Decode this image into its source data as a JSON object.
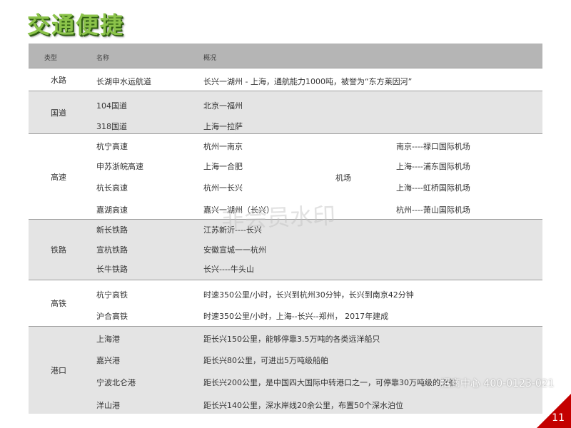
{
  "title": "交通便捷",
  "table": {
    "headers": {
      "type": "类型",
      "name": "名称",
      "desc": "概况"
    },
    "groups": [
      {
        "type": "水路",
        "rows": [
          {
            "name": "长湖申水运航道",
            "desc": "长兴一湖州 - 上海，通航能力1000吨，被誉为“东方莱因河”"
          }
        ]
      },
      {
        "type": "国道",
        "rows": [
          {
            "name": "104国道",
            "desc": "北京一福州"
          },
          {
            "name": "318国道",
            "desc": "上海一拉萨"
          }
        ]
      },
      {
        "type": "高速",
        "mid_label": "机场",
        "rows": [
          {
            "name": "杭宁高速",
            "desc": "杭州一南京",
            "airport": "南京----禄口国际机场"
          },
          {
            "name": "申苏浙皖高速",
            "desc": "上海一合肥",
            "airport": "上海----浦东国际机场"
          },
          {
            "name": "杭长高速",
            "desc": "杭州一长兴",
            "airport": "上海----虹桥国际机场"
          },
          {
            "name": "嘉湖高速",
            "desc": "嘉兴一湖州（长兴）",
            "airport": "杭州----萧山国际机场"
          }
        ]
      },
      {
        "type": "铁路",
        "rows": [
          {
            "name": "新长铁路",
            "desc": "江苏新沂----长兴"
          },
          {
            "name": "宣杭铁路",
            "desc": "安徽宣城一一杭州"
          },
          {
            "name": "长牛铁路",
            "desc": "长兴----牛头山"
          }
        ]
      },
      {
        "type": "高铁",
        "rows": [
          {
            "name": "杭宁高铁",
            "desc": "时速350公里/小时，长兴到杭州30分钟，长兴到南京42分钟"
          },
          {
            "name": "沪合高铁",
            "desc": "时速350公里/小时，上海--长兴--郑州， 2017年建成"
          }
        ]
      },
      {
        "type": "港口",
        "rows": [
          {
            "name": "上海港",
            "desc": "距长兴150公里，能够停靠3.5万吨的各类远洋船只"
          },
          {
            "name": "嘉兴港",
            "desc": "距长兴80公里，可进出5万吨级船舶"
          },
          {
            "name": "宁波北仑港",
            "desc": "距长兴200公里，是中国四大国际中转港口之一，可停靠30万吨级的货船"
          },
          {
            "name": "洋山港",
            "desc": "距长兴140公里，深水岸线20余公里，布置50个深水泊位"
          }
        ]
      }
    ]
  },
  "watermark": "非会员水印",
  "hotline": "招商中心 400-0123-021",
  "page_number": "11",
  "colors": {
    "header_bg": "#b5b5b5",
    "band_gray": "#e4e4e4",
    "title_green": "#8bc34a",
    "corner_red": "#c40000"
  }
}
